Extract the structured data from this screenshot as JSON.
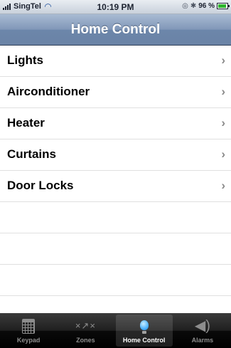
{
  "status_bar": {
    "carrier": "SingTel",
    "time": "10:19 PM",
    "battery": "96 %",
    "signal_icon": "signal-bars-icon",
    "wifi_icon": "wifi-icon",
    "lock_icon": "rotation-lock-icon",
    "bluetooth_icon": "bluetooth-icon",
    "battery_icon": "battery-icon"
  },
  "nav": {
    "title": "Home Control"
  },
  "list": {
    "items": [
      {
        "label": "Lights"
      },
      {
        "label": "Airconditioner"
      },
      {
        "label": "Heater"
      },
      {
        "label": "Curtains"
      },
      {
        "label": "Door Locks"
      }
    ],
    "chevron": "›"
  },
  "tab_bar": {
    "tabs": [
      {
        "label": "Keypad",
        "icon": "keypad-calendar-icon"
      },
      {
        "label": "Zones",
        "icon": "zones-icon"
      },
      {
        "label": "Home Control",
        "icon": "lightbulb-icon",
        "active": true
      },
      {
        "label": "Alarms",
        "icon": "speaker-icon"
      }
    ]
  },
  "colors": {
    "nav_bar": "#7a93b6",
    "tab_active": "#4db2ff",
    "tab_inactive": "#8d8d8d",
    "battery_fill": "#2fb52f"
  }
}
